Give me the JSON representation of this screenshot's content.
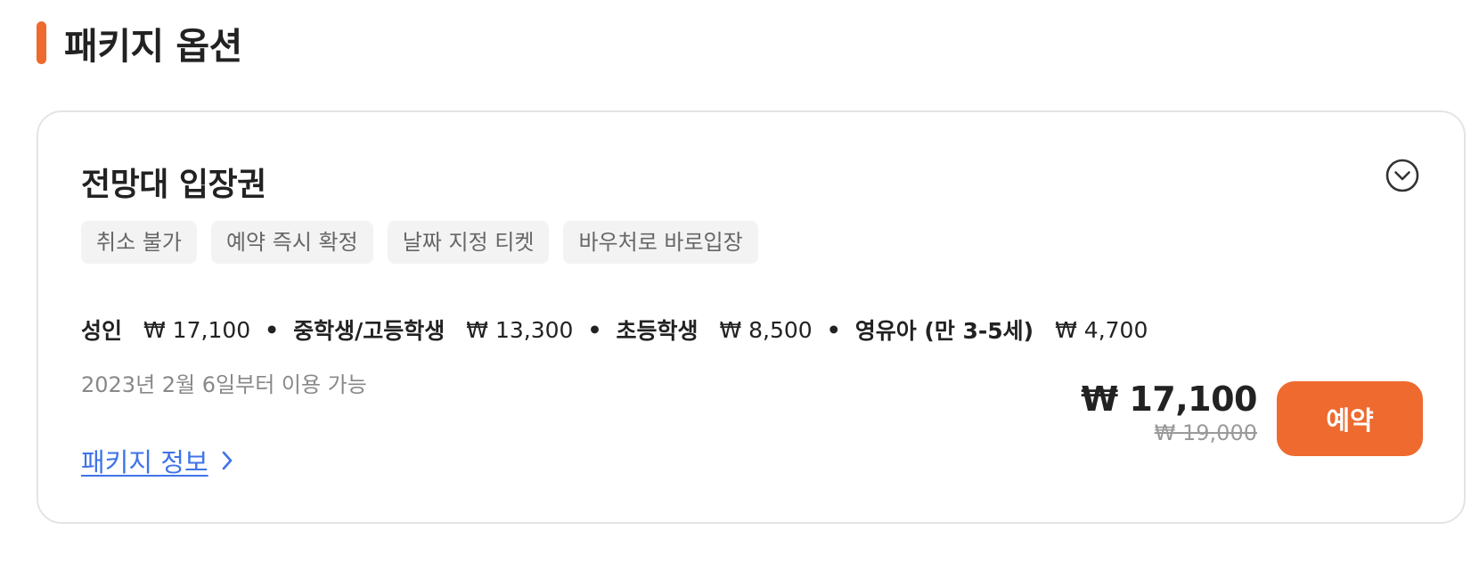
{
  "section": {
    "title": "패키지 옵션"
  },
  "option": {
    "title": "전망대 입장권",
    "tags": [
      "취소 불가",
      "예약 즉시 확정",
      "날짜 지정 티켓",
      "바우처로 바로입장"
    ],
    "prices": [
      {
        "label": "성인",
        "value": "₩ 17,100"
      },
      {
        "label": "중학생/고등학생",
        "value": "₩ 13,300"
      },
      {
        "label": "초등학생",
        "value": "₩ 8,500"
      },
      {
        "label": "영유아 (만 3-5세)",
        "value": "₩ 4,700"
      }
    ],
    "separator": "•",
    "availability": "2023년 2월 6일부터 이용 가능",
    "info_link": "패키지 정보",
    "price_now": "₩ 17,100",
    "price_original": "₩ 19,000",
    "book_label": "예약"
  },
  "icons": {
    "expand": "chevron-down-circle-icon",
    "link_arrow": "chevron-right-icon"
  },
  "colors": {
    "accent": "#EE6A2E",
    "link": "#3F73E8",
    "tag_bg": "#F3F3F3",
    "border": "#E4E4E4"
  }
}
